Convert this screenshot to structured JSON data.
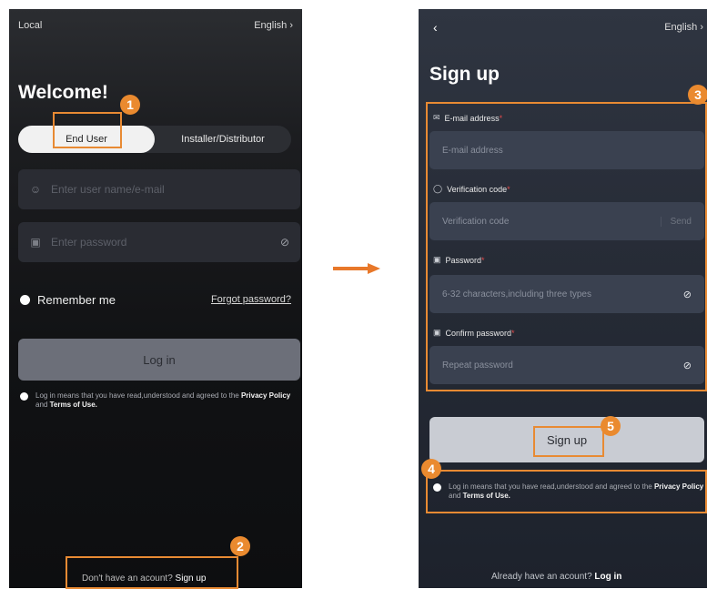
{
  "left_screen": {
    "location": "Local",
    "language": "English",
    "language_chevron": "›",
    "welcome": "Welcome!",
    "roles": [
      "End User",
      "Installer/Distributor"
    ],
    "username_placeholder": "Enter user name/e-mail",
    "password_placeholder": "Enter password",
    "remember_me": "Remember me",
    "forgot_password": "Forgot password?",
    "login_button": "Log in",
    "agreement": {
      "prefix": "Log in means that you have read,understood and agreed to the",
      "privacy": "Privacy Policy",
      "and": "and",
      "terms": "Terms of Use."
    },
    "signup_prompt": "Don't have an acount?",
    "signup_link": "Sign up",
    "icons": {
      "user": "user-icon",
      "lock": "lock-icon",
      "eye": "eye-off-icon"
    }
  },
  "right_screen": {
    "back": "‹",
    "language": "English",
    "language_chevron": "›",
    "title": "Sign up",
    "email_label": "E-mail address",
    "email_placeholder": "E-mail address",
    "code_label": "Verification code",
    "code_placeholder": "Verification code",
    "send": "Send",
    "password_label": "Password",
    "password_placeholder": "6-32 characters,including three types",
    "confirm_label": "Confirm password",
    "confirm_placeholder": "Repeat password",
    "required_mark": "*",
    "signup_button": "Sign up",
    "agreement": {
      "prefix": "Log in means that you have read,understood and agreed to the",
      "privacy": "Privacy Policy",
      "and": "and",
      "terms": "Terms of Use."
    },
    "login_prompt": "Already have an acount?",
    "login_link": "Log in"
  },
  "annotations": [
    "1",
    "2",
    "3",
    "4",
    "5"
  ],
  "colors": {
    "accent": "#e88a33",
    "dark_bg": "#111214",
    "signup_bg": "#272c37"
  }
}
